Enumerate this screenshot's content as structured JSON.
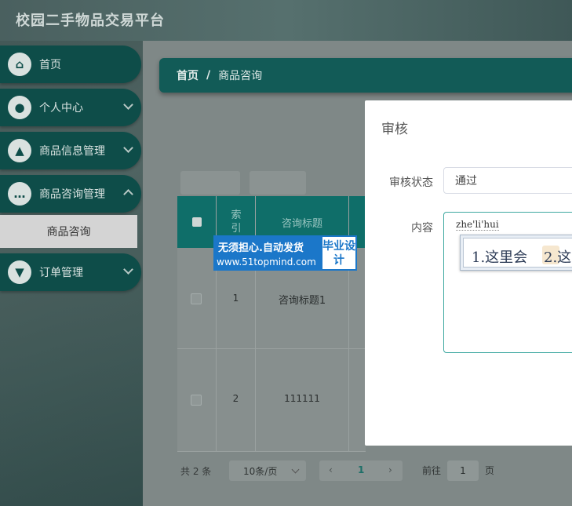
{
  "app": {
    "title": "校园二手物品交易平台"
  },
  "sidebar": {
    "items": [
      {
        "label": "首页",
        "icon": "home-icon",
        "glyph": "⌂"
      },
      {
        "label": "个人中心",
        "icon": "user-icon",
        "glyph": "●"
      },
      {
        "label": "商品信息管理",
        "icon": "person-badge-icon",
        "glyph": "▲"
      },
      {
        "label": "商品咨询管理",
        "icon": "chat-icon",
        "glyph": "…"
      },
      {
        "label": "订单管理",
        "icon": "pin-icon",
        "glyph": "▼"
      }
    ],
    "submenu_active": "商品咨询"
  },
  "breadcrumb": {
    "home": "首页",
    "separator": "/",
    "current": "商品咨询"
  },
  "table": {
    "columns": [
      "索引",
      "咨询标题"
    ],
    "rows": [
      {
        "index": "1",
        "title": "咨询标题1"
      },
      {
        "index": "2",
        "title": "111111"
      }
    ]
  },
  "pagination": {
    "total_text": "共 2 条",
    "page_size": "10条/页",
    "prev": "‹",
    "current_page": "1",
    "next": "›",
    "goto_label": "前往",
    "goto_value": "1",
    "goto_suffix": "页"
  },
  "dialog": {
    "title": "审核",
    "status_label": "审核状态",
    "status_value": "通过",
    "content_label": "内容",
    "ime_typed": "zhe'li'hui",
    "ime_candidate_1": "1.这里会",
    "ime_candidate_2": "2.这"
  },
  "watermark": {
    "line1": "无须担心.自动发货",
    "line2": "www.51topmind.com",
    "badge": "毕业设计"
  },
  "colors": {
    "primary": "#0e4d49",
    "header_teal": "#0f6e69",
    "focus_border": "#3fa9a1",
    "watermark_blue": "#1b77c9"
  }
}
